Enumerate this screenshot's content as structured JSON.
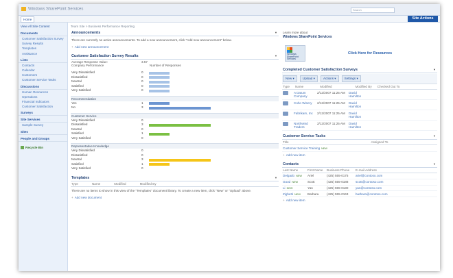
{
  "header": {
    "site_title": "Windows SharePoint Services",
    "search_placeholder": "Search",
    "home_tab": "Home",
    "site_actions": "Site Actions"
  },
  "left_nav": {
    "view_all": "View All Site Content",
    "sections": [
      {
        "title": "Documents",
        "items": [
          "Customer Satisfaction Survey",
          "Survey Results",
          "Templates",
          "Assistance"
        ]
      },
      {
        "title": "Lists",
        "items": [
          "Contacts",
          "Calendar",
          "Customers",
          "Customer Service Tasks"
        ]
      },
      {
        "title": "Discussions",
        "items": [
          "Human Resources",
          "Operations",
          "Financial Indicators",
          "Customer Satisfaction"
        ]
      }
    ],
    "links": [
      "Surveys",
      "Site Services",
      "Sample Survey",
      "Sites",
      "People and Groups"
    ],
    "recycle_bin": "Recycle Bin"
  },
  "breadcrumb": "Team Site > Business Performance Reporting",
  "announcements": {
    "title": "Announcements",
    "empty_text": "There are currently no active announcements. To add a new announcement, click \"Add new announcement\" below.",
    "add_link": "Add new announcement"
  },
  "survey": {
    "title": "Customer Satisfaction Survey Results",
    "avg_label": "Average Response Value:",
    "avg_value": "3.57",
    "col1": "Company Performance",
    "col2": "Number of Responses",
    "groups": [
      {
        "title": "",
        "rows": [
          {
            "label": "Very Dissatisfied",
            "count": 0,
            "color": "#a7c3e6"
          },
          {
            "label": "Dissatisfied",
            "count": 0,
            "color": "#a7c3e6"
          },
          {
            "label": "Neutral",
            "count": 0,
            "color": "#a7c3e6"
          },
          {
            "label": "Satisfied",
            "count": 0,
            "color": "#a7c3e6"
          },
          {
            "label": "Very Satisfied",
            "count": 0,
            "color": "#a7c3e6"
          }
        ],
        "fills": [
          0.2,
          0.2,
          0.2,
          0.2,
          0.2
        ]
      },
      {
        "title": "Recommendation",
        "rows": [
          {
            "label": "Yes",
            "count": 1,
            "color": "#6c95d1"
          },
          {
            "label": "No",
            "count": 3,
            "color": "#6c95d1"
          }
        ],
        "fills": [
          0.2,
          0.61
        ]
      },
      {
        "title": "Customer Service",
        "rows": [
          {
            "label": "Very Dissatisfied",
            "count": 0,
            "color": "#7bc043"
          },
          {
            "label": "Dissatisfied",
            "count": 3,
            "color": "#7bc043"
          },
          {
            "label": "Neutral",
            "count": 0,
            "color": "#7bc043"
          },
          {
            "label": "Satisfied",
            "count": 1,
            "color": "#7bc043"
          },
          {
            "label": "Very Satisfied",
            "count": 0,
            "color": "#7bc043"
          }
        ],
        "fills": [
          0,
          0.61,
          0,
          0.2,
          0
        ]
      },
      {
        "title": "Representative Knowledge",
        "rows": [
          {
            "label": "Very Dissatisfied",
            "count": 0,
            "color": "#f5c518"
          },
          {
            "label": "Dissatisfied",
            "count": 0,
            "color": "#f5c518"
          },
          {
            "label": "Neutral",
            "count": 3,
            "color": "#f5c518"
          },
          {
            "label": "Satisfied",
            "count": 1,
            "color": "#f5c518"
          },
          {
            "label": "Very Satisfied",
            "count": 0,
            "color": "#f5c518"
          }
        ],
        "fills": [
          0,
          0,
          0.61,
          0.2,
          0
        ]
      }
    ]
  },
  "templates": {
    "title": "Templates",
    "cols": [
      "Type",
      "Name",
      "Modified",
      "Modified By"
    ],
    "empty_text": "There are no items to show in this view of the \"Templates\" document library. To create a new item, click \"New\" or \"Upload\" above.",
    "add_link": "Add new document"
  },
  "learn": {
    "top": "Learn more about",
    "head": "Windows SharePoint Services",
    "logo_text": "Windows SharePoint Services",
    "link": "Click Here for Resources"
  },
  "completed": {
    "title": "Completed Customer Satisfaction Surveys",
    "toolbar": [
      "New",
      "Upload",
      "Actions",
      "Settings"
    ],
    "cols": [
      "Type",
      "Name",
      "Modified",
      "Modified By",
      "Checked Out To"
    ],
    "rows": [
      {
        "name": "A Datum Company",
        "modified": "2/12/2007 11:25 AM",
        "by": "David Hamilton"
      },
      {
        "name": "Coho Winery",
        "modified": "2/12/2007 11:25 AM",
        "by": "David Hamilton"
      },
      {
        "name": "Fabrikam, Inc",
        "modified": "2/12/2007 11:25 AM",
        "by": "David Hamilton"
      },
      {
        "name": "Northwind Traders",
        "modified": "2/12/2007 11:25 AM",
        "by": "David Hamilton"
      }
    ]
  },
  "tasks": {
    "title": "Customer Service Tasks",
    "cols": [
      "Title",
      "Assigned To"
    ],
    "item": "Customer Service Training",
    "new": "NEW",
    "add_link": "Add new item"
  },
  "contacts": {
    "title": "Contacts",
    "cols": [
      "Last Name",
      "First Name",
      "Business Phone",
      "E-mail Address"
    ],
    "rows": [
      {
        "last": "Delgado",
        "first": "Ariel",
        "phone": "(425) 555-0175",
        "email": "ariel@contoso.com"
      },
      {
        "last": "Good",
        "first": "Scott",
        "phone": "(425) 555-0188",
        "email": "scott@contoso.com"
      },
      {
        "last": "Li",
        "first": "Yan",
        "phone": "(425) 555-0130",
        "email": "yan@contoso.com"
      },
      {
        "last": "Zighetti",
        "first": "Barbara",
        "phone": "(425) 555-0163",
        "email": "barbara@contoso.com"
      }
    ],
    "new": "NEW",
    "add_link": "Add new item"
  }
}
